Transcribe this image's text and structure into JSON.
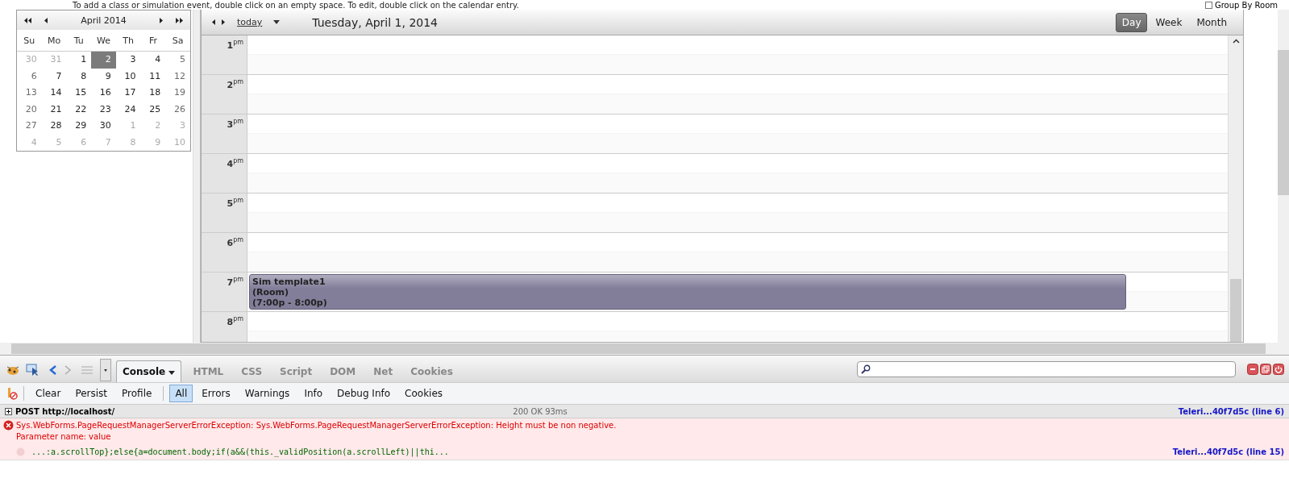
{
  "top_hint": "To add a class or simulation event, double click on an empty space. To edit, double click on the calendar entry.",
  "group_by": {
    "label": "Group By Room",
    "checked": false
  },
  "mini_calendar": {
    "title": "April 2014",
    "weekdays": [
      "Su",
      "Mo",
      "Tu",
      "We",
      "Th",
      "Fr",
      "Sa"
    ],
    "weeks": [
      [
        {
          "d": "30",
          "other": true,
          "selected": false
        },
        {
          "d": "31",
          "other": true,
          "selected": false
        },
        {
          "d": "1",
          "other": false,
          "selected": false
        },
        {
          "d": "2",
          "other": false,
          "selected": true
        },
        {
          "d": "3",
          "other": false,
          "selected": false
        },
        {
          "d": "4",
          "other": false,
          "selected": false
        },
        {
          "d": "5",
          "other": false,
          "selected": false
        }
      ],
      [
        {
          "d": "6",
          "other": false,
          "selected": false
        },
        {
          "d": "7",
          "other": false,
          "selected": false
        },
        {
          "d": "8",
          "other": false,
          "selected": false
        },
        {
          "d": "9",
          "other": false,
          "selected": false
        },
        {
          "d": "10",
          "other": false,
          "selected": false
        },
        {
          "d": "11",
          "other": false,
          "selected": false
        },
        {
          "d": "12",
          "other": false,
          "selected": false
        }
      ],
      [
        {
          "d": "13",
          "other": false,
          "selected": false
        },
        {
          "d": "14",
          "other": false,
          "selected": false
        },
        {
          "d": "15",
          "other": false,
          "selected": false
        },
        {
          "d": "16",
          "other": false,
          "selected": false
        },
        {
          "d": "17",
          "other": false,
          "selected": false
        },
        {
          "d": "18",
          "other": false,
          "selected": false
        },
        {
          "d": "19",
          "other": false,
          "selected": false
        }
      ],
      [
        {
          "d": "20",
          "other": false,
          "selected": false
        },
        {
          "d": "21",
          "other": false,
          "selected": false
        },
        {
          "d": "22",
          "other": false,
          "selected": false
        },
        {
          "d": "23",
          "other": false,
          "selected": false
        },
        {
          "d": "24",
          "other": false,
          "selected": false
        },
        {
          "d": "25",
          "other": false,
          "selected": false
        },
        {
          "d": "26",
          "other": false,
          "selected": false
        }
      ],
      [
        {
          "d": "27",
          "other": false,
          "selected": false
        },
        {
          "d": "28",
          "other": false,
          "selected": false
        },
        {
          "d": "29",
          "other": false,
          "selected": false
        },
        {
          "d": "30",
          "other": false,
          "selected": false
        },
        {
          "d": "1",
          "other": true,
          "selected": false
        },
        {
          "d": "2",
          "other": true,
          "selected": false
        },
        {
          "d": "3",
          "other": true,
          "selected": false
        }
      ],
      [
        {
          "d": "4",
          "other": true,
          "selected": false
        },
        {
          "d": "5",
          "other": true,
          "selected": false
        },
        {
          "d": "6",
          "other": true,
          "selected": false
        },
        {
          "d": "7",
          "other": true,
          "selected": false
        },
        {
          "d": "8",
          "other": true,
          "selected": false
        },
        {
          "d": "9",
          "other": true,
          "selected": false
        },
        {
          "d": "10",
          "other": true,
          "selected": false
        }
      ]
    ]
  },
  "scheduler": {
    "today": "today",
    "date_title": "Tuesday, April 1, 2014",
    "views": [
      {
        "label": "Day",
        "selected": true
      },
      {
        "label": "Week",
        "selected": false
      },
      {
        "label": "Month",
        "selected": false
      }
    ],
    "hours": [
      {
        "label": "1$^{pm}$"
      },
      {
        "label": "2$^{pm}$"
      },
      {
        "label": "3$^{pm}$"
      },
      {
        "label": "4$^{pm}$"
      },
      {
        "label": "5$^{pm}$"
      },
      {
        "label": "6$^{pm}$"
      },
      {
        "label": "7$^{pm}$",
        "events": [
          {
            "title": "Sim template1",
            "room": "(Room)",
            "time": "(7:00p - 8:00p)"
          }
        ]
      },
      {
        "label": "8$^{pm}$"
      }
    ]
  },
  "devtools": {
    "panels": [
      {
        "label": "Console",
        "selected": true
      },
      {
        "label": "HTML",
        "selected": false
      },
      {
        "label": "CSS",
        "selected": false
      },
      {
        "label": "Script",
        "selected": false
      },
      {
        "label": "DOM",
        "selected": false
      },
      {
        "label": "Net",
        "selected": false
      },
      {
        "label": "Cookies",
        "selected": false
      }
    ],
    "commands": [
      "Clear",
      "Persist",
      "Profile"
    ],
    "filters": [
      {
        "label": "All",
        "selected": true
      },
      {
        "label": "Errors",
        "selected": false
      },
      {
        "label": "Warnings",
        "selected": false
      },
      {
        "label": "Info",
        "selected": false
      },
      {
        "label": "Debug Info",
        "selected": false
      },
      {
        "label": "Cookies",
        "selected": false
      }
    ],
    "request": {
      "method_url": "POST http://localhost/",
      "status": "200 OK 93ms",
      "source": "Teleri...40f7d5c (line 6)"
    },
    "error": {
      "message": "Sys.WebForms.PageRequestManagerServerErrorException: Sys.WebForms.PageRequestManagerServerErrorException: Height must be non negative.",
      "detail": "Parameter name: value",
      "code": "...:a.scrollTop};else{a=document.body;if(a&&(this._validPosition(a.scrollLeft)||thi...",
      "source": "Teleri...40f7d5c (line 15)"
    }
  }
}
